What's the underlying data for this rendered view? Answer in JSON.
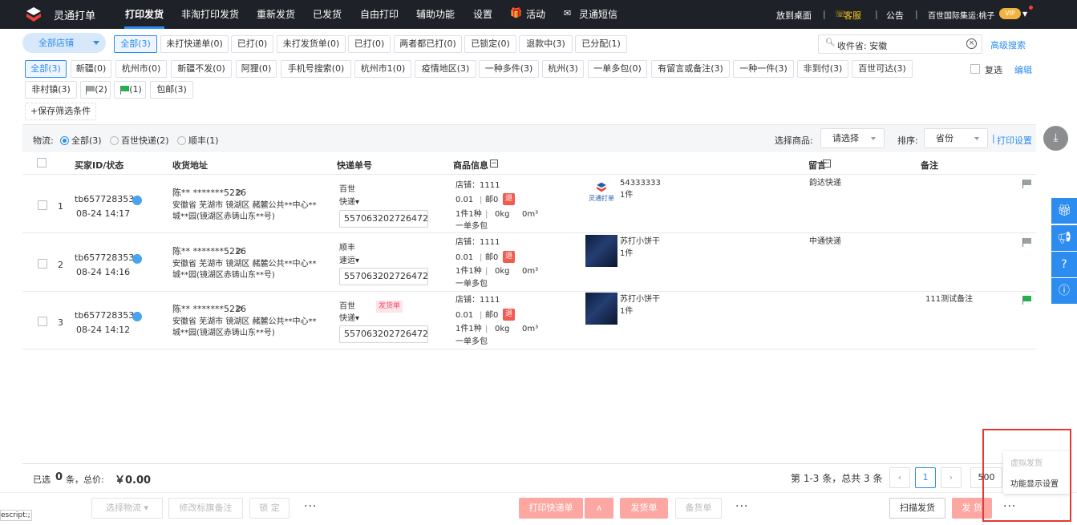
{
  "topbar": {
    "app_name": "灵通打单",
    "nav": [
      "打印发货",
      "非淘打印发货",
      "重新发货",
      "已发货",
      "自由打印",
      "辅助功能",
      "设置",
      "活动",
      "灵通短信"
    ],
    "put_desktop": "放到桌面",
    "support": "客服",
    "notice": "公告",
    "account": "百世国际集运:桃子",
    "vip_badge": "VIP"
  },
  "store_select": "全部店铺",
  "status_tabs": [
    "全部(3)",
    "未打快递单(0)",
    "已打(0)",
    "未打发货单(0)",
    "已打(0)",
    "两者都已打(0)",
    "已锁定(0)",
    "退款中(3)",
    "已分配(1)"
  ],
  "search": {
    "value": "收件省: 安徽",
    "advanced": "高级搜索"
  },
  "tags_row1": [
    "全部(3)",
    "新疆(0)",
    "杭州市(0)",
    "新疆不发(0)",
    "阿狸(0)",
    "手机号搜索(0)",
    "杭州市1(0)",
    "疫情地区(3)",
    "一种多件(3)",
    "杭州(3)",
    "一单多包(0)",
    "有留言或备注(3)",
    "一种一件(3)",
    "非到付(3)",
    "百世可达(3)"
  ],
  "multi_select": "复选",
  "edit": "编辑",
  "tags_row2": [
    "非村镇(3)",
    "(2)",
    "(1)",
    "包邮(3)"
  ],
  "save_filter": "+保存筛选条件",
  "filter": {
    "logistics_label": "物流:",
    "logistics_options": [
      "全部(3)",
      "百世快递(2)",
      "顺丰(1)"
    ],
    "select_goods_label": "选择商品:",
    "select_goods_value": "请选择",
    "sort_label": "排序:",
    "sort_value": "省份",
    "print_settings": "打印设置"
  },
  "table": {
    "headers": [
      "买家ID/状态",
      "收货地址",
      "快递单号",
      "商品信息",
      "留言",
      "备注"
    ],
    "rows": [
      {
        "index": "1",
        "buyer": "tb6577283536",
        "time": "08-24 14:17",
        "name": "陈** *******5226",
        "addr1": "安徽省 芜湖市 镜湖区 赭麓公共**中心**",
        "addr2": "城**园(镜湖区赤铸山东**号)",
        "courier": "百世",
        "courier_type": "快递",
        "invoice_tag": "",
        "tracking": "557063202726472",
        "shop": "店铺：1111",
        "price": "0.01",
        "post": "邮0",
        "refund": "退",
        "qty": "1件1种",
        "weight": "0kg",
        "volume": "0m³",
        "multipkg": "一单多包",
        "prod_name": "54333333",
        "prod_qty": "1件",
        "thumb_text": "灵通打单",
        "message": "韵达快递",
        "remark": "",
        "flag_color": "#9aa29d"
      },
      {
        "index": "2",
        "buyer": "tb6577283536",
        "time": "08-24 14:16",
        "name": "陈** *******5226",
        "addr1": "安徽省 芜湖市 镜湖区 赭麓公共**中心**",
        "addr2": "城**园(镜湖区赤铸山东**号)",
        "courier": "顺丰",
        "courier_type": "速运",
        "invoice_tag": "",
        "tracking": "557063202726472",
        "shop": "店铺：1111",
        "price": "0.01",
        "post": "邮0",
        "refund": "退",
        "qty": "1件1种",
        "weight": "0kg",
        "volume": "0m³",
        "multipkg": "一单多包",
        "prod_name": "苏打小饼干",
        "prod_qty": "1件",
        "thumb_text": "",
        "message": "中通快递",
        "remark": "",
        "flag_color": "#9aa29d"
      },
      {
        "index": "3",
        "buyer": "tb6577283536",
        "time": "08-24 14:12",
        "name": "陈** *******5226",
        "addr1": "安徽省 芜湖市 镜湖区 赭麓公共**中心**",
        "addr2": "城**园(镜湖区赤铸山东**号)",
        "courier": "百世",
        "courier_type": "快递",
        "invoice_tag": "发货单",
        "tracking": "557063202726472",
        "shop": "店铺：1111",
        "price": "0.01",
        "post": "邮0",
        "refund": "退",
        "qty": "1件1种",
        "weight": "0kg",
        "volume": "0m³",
        "multipkg": "一单多包",
        "prod_name": "苏打小饼干",
        "prod_qty": "1件",
        "thumb_text": "",
        "message": "",
        "remark": "111测试备注",
        "flag_color": "#22b14c"
      }
    ]
  },
  "footer": {
    "selected_prefix": "已选",
    "selected_count": "0",
    "selected_unit": "条，总价:",
    "total": "￥0.00",
    "pagination": "第 1-3 条，总共 3 条",
    "page": "1",
    "page_size": "500"
  },
  "actions": [
    "选择物流",
    "修改标旗备注",
    "锁 定",
    "打印快递单",
    "发货单",
    "备货单",
    "扫描发货",
    "发 货"
  ],
  "popup": [
    "虚拟发货",
    "功能显示设置"
  ],
  "js_message": "escript:;"
}
